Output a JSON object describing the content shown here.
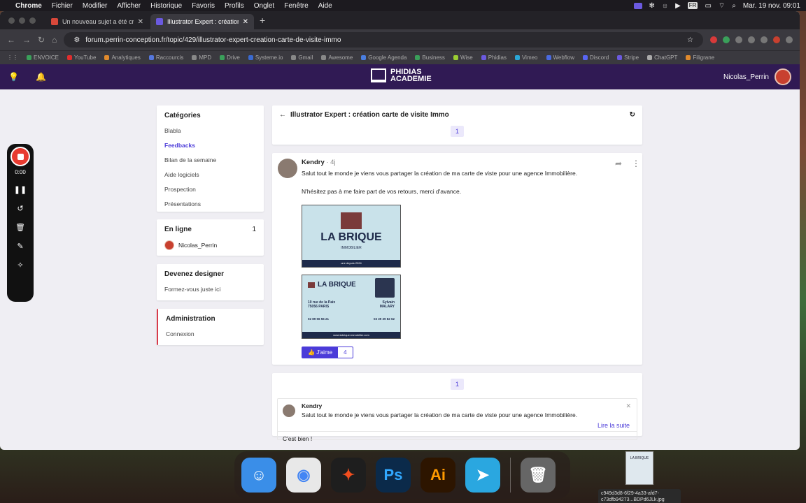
{
  "menubar": {
    "app": "Chrome",
    "items": [
      "Fichier",
      "Modifier",
      "Afficher",
      "Historique",
      "Favoris",
      "Profils",
      "Onglet",
      "Fenêtre",
      "Aide"
    ],
    "lang": "FR",
    "datetime": "Mar. 19 nov.  09:01"
  },
  "tabs": [
    {
      "title": "Un nouveau sujet a été créé",
      "color": "#d8483a"
    },
    {
      "title": "Illustrator Expert : création ca",
      "color": "#6b5ae0"
    }
  ],
  "address": {
    "url": "forum.perrin-conception.fr/topic/429/illustrator-expert-creation-carte-de-visite-immo"
  },
  "bookmarks": [
    {
      "label": "ENVOICE",
      "color": "#3aa05a"
    },
    {
      "label": "YouTube",
      "color": "#e02d2d"
    },
    {
      "label": "Analytiques",
      "color": "#e08a2d"
    },
    {
      "label": "Raccourcis",
      "color": "#5577dd"
    },
    {
      "label": "MPD",
      "color": "#888"
    },
    {
      "label": "Drive",
      "color": "#3aa05a"
    },
    {
      "label": "Systeme.io",
      "color": "#3a6ad0"
    },
    {
      "label": "Gmail",
      "color": "#888"
    },
    {
      "label": "Awesome",
      "color": "#888"
    },
    {
      "label": "Google Agenda",
      "color": "#4a7ee0"
    },
    {
      "label": "Business",
      "color": "#3aa05a"
    },
    {
      "label": "Wise",
      "color": "#9acd32"
    },
    {
      "label": "Phidias",
      "color": "#6b5ae0"
    },
    {
      "label": "Vimeo",
      "color": "#2aa7d8"
    },
    {
      "label": "Webflow",
      "color": "#4a6ae0"
    },
    {
      "label": "Discord",
      "color": "#5865f2"
    },
    {
      "label": "Stripe",
      "color": "#6b5ae0"
    },
    {
      "label": "ChatGPT",
      "color": "#aaa"
    },
    {
      "label": "Filigrane",
      "color": "#e08a2d"
    }
  ],
  "site": {
    "logo_line1": "PHIDIAS",
    "logo_line2": "ACADEMIE",
    "username": "Nicolas_Perrin"
  },
  "sidebar": {
    "categories": {
      "title": "Catégories",
      "items": [
        {
          "label": "Blabla"
        },
        {
          "label": "Feedbacks",
          "active": true
        },
        {
          "label": "Bilan de la semaine"
        },
        {
          "label": "Aide logiciels"
        },
        {
          "label": "Prospection"
        },
        {
          "label": "Présentations"
        }
      ]
    },
    "online": {
      "title": "En ligne",
      "count": "1",
      "user": "Nicolas_Perrin"
    },
    "designer": {
      "title": "Devenez designer",
      "link": "Formez-vous juste ici"
    },
    "admin": {
      "title": "Administration",
      "link": "Connexion"
    }
  },
  "topic": {
    "back": "←",
    "title": "Illustrator Expert : création carte de visite Immo",
    "page": "1"
  },
  "post": {
    "author": "Kendry",
    "time": "· 4j",
    "line1": "Salut tout le monde je viens vous partager la création de ma carte de viste pour une agence Immobilière.",
    "line2": "N'hésitez pas à me faire part de vos retours, merci d'avance.",
    "card_front": {
      "brand": "LA BRIQUE",
      "sub": "IMMOBILIER",
      "since": "une depuis 2024"
    },
    "card_back": {
      "brand": "LA BRIQUE",
      "address1": "10 rue de la Paix",
      "address2": "75056 PARIS",
      "name1": "Sylvain",
      "name2": "MALARY",
      "phone1": "02 89 56 56 21",
      "phone2": "03 39 39 82 62",
      "web": "www.labrique-immobilier.com"
    },
    "like_label": "J'aime",
    "like_count": "4"
  },
  "reply": {
    "page": "1",
    "author": "Kendry",
    "quote": "Salut tout le monde je viens vous partager la création de ma carte de viste pour une agence Immobilière.",
    "read_more": "Lire la suite",
    "text": "C'est bien !"
  },
  "recorder": {
    "time": "0:00"
  },
  "dock": {
    "apps": [
      {
        "name": "Finder",
        "glyph": "☺",
        "color": "#3a8ee8"
      },
      {
        "name": "Chrome",
        "glyph": "◉",
        "color": "#e8e8e8"
      },
      {
        "name": "Figma",
        "glyph": "✦",
        "color": "#1e1e1e"
      },
      {
        "name": "Photoshop",
        "glyph": "Ps",
        "color": "#0b2a4a"
      },
      {
        "name": "Illustrator",
        "glyph": "Ai",
        "color": "#2d1500"
      },
      {
        "name": "Telegram",
        "glyph": "➤",
        "color": "#2aa7e0"
      },
      {
        "name": "Trash",
        "glyph": "🗑",
        "color": "#666"
      }
    ]
  },
  "desktop_file": {
    "name1": "c949d3d8-6f29-4a33-afd7-",
    "name2": "c73dfb94273...BDPd6JLk.jpg",
    "thumb": "LA BRIQUE"
  }
}
